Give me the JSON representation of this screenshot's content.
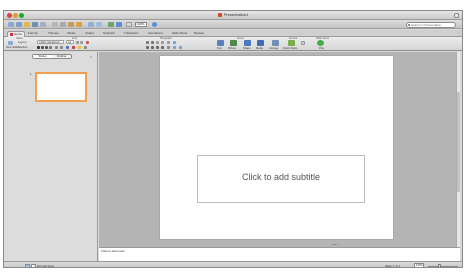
{
  "window": {
    "title": "Presentation1"
  },
  "search": {
    "placeholder": "Search in Presentation"
  },
  "toolbar": {
    "zoom_value": "100%"
  },
  "ribbon": {
    "tabs": [
      {
        "label": "Home"
      },
      {
        "label": "Format"
      },
      {
        "label": "Themes"
      },
      {
        "label": "Tables"
      },
      {
        "label": "Charts"
      },
      {
        "label": "SmartArt"
      },
      {
        "label": "Transitions"
      },
      {
        "label": "Animations"
      },
      {
        "label": "Slide Show"
      },
      {
        "label": "Review"
      }
    ],
    "groups": {
      "slides": "Slides",
      "font": "Font",
      "paragraph": "Paragraph",
      "insert": "Insert",
      "format": "Format",
      "slide_show": "Slide Show"
    },
    "new_slide": "New Slide",
    "layout": "Layout",
    "section": "Section",
    "font_name": "Calibri (Headings)",
    "font_size": "44",
    "insert_buttons": {
      "text": "Text",
      "picture": "Picture",
      "shape": "Shape",
      "media": "Media"
    },
    "format_buttons": {
      "arrange": "Arrange",
      "quick_styles": "Quick Styles"
    },
    "play": "Play"
  },
  "pane": {
    "tab_slides": "Slides",
    "tab_outline": "Outline",
    "thumb_number": "1"
  },
  "slide": {
    "subtitle_placeholder": "Click to add subtitle"
  },
  "notes": {
    "placeholder": "Click to add notes"
  },
  "status": {
    "view_name": "Normal View",
    "slide_count": "Slide 1 of 1",
    "zoom_value": "100%"
  },
  "colors": {
    "thumb_border": "#f0a050",
    "ppt_accent": "#d24726"
  }
}
